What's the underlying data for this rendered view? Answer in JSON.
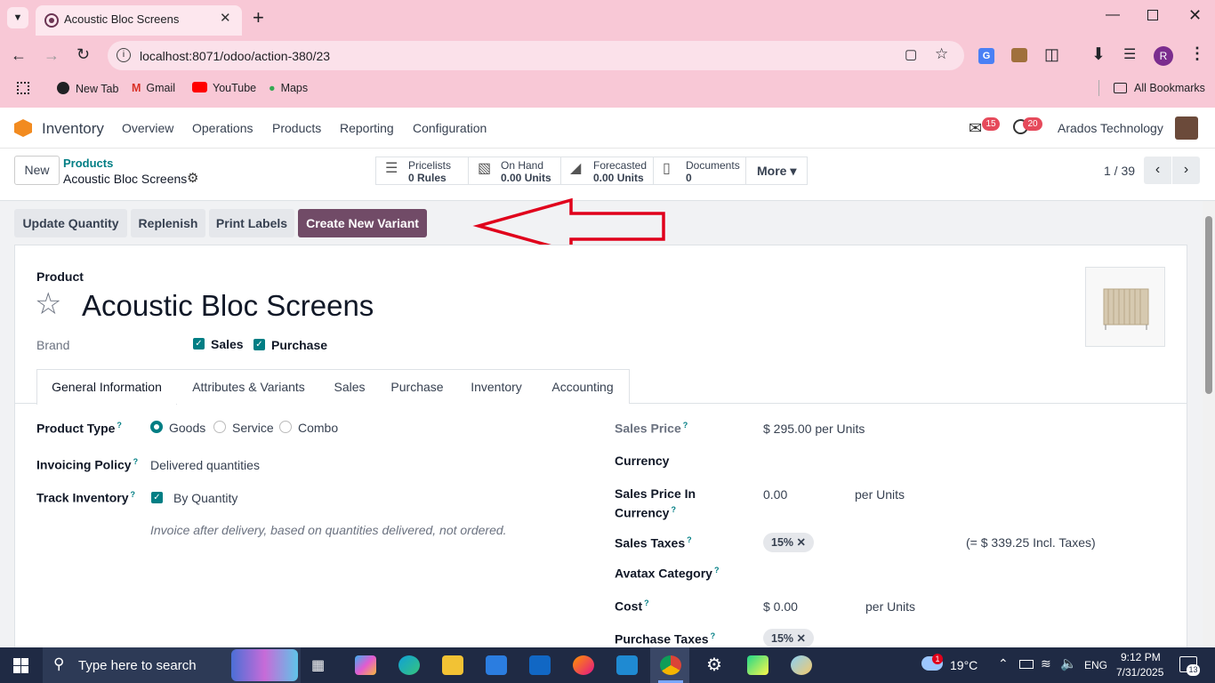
{
  "browser": {
    "tab_title": "Acoustic Bloc Screens",
    "new_tab_symbol": "+",
    "url": "localhost:8071/odoo/action-380/23",
    "bookmarks": [
      "New Tab",
      "Gmail",
      "YouTube",
      "Maps"
    ],
    "all_bookmarks": "All Bookmarks",
    "profile_initial": "R"
  },
  "app": {
    "name": "Inventory",
    "menu": [
      "Overview",
      "Operations",
      "Products",
      "Reporting",
      "Configuration"
    ],
    "chat_badge": "15",
    "activity_badge": "20",
    "company": "Arados Technology"
  },
  "control": {
    "new_label": "New",
    "breadcrumb_parent": "Products",
    "breadcrumb_current": "Acoustic Bloc Screens",
    "stats": [
      {
        "label": "Pricelists",
        "value": "0 Rules"
      },
      {
        "label": "On Hand",
        "value": "0.00 Units"
      },
      {
        "label": "Forecasted",
        "value": "0.00 Units"
      },
      {
        "label": "Documents",
        "value": "0"
      }
    ],
    "more_label": "More",
    "pager": "1 / 39"
  },
  "actions": [
    "Update Quantity",
    "Replenish",
    "Print Labels",
    "Create New Variant"
  ],
  "form": {
    "product_label": "Product",
    "product_name": "Acoustic Bloc Screens",
    "brand_label": "Brand",
    "sales_check": "Sales",
    "purchase_check": "Purchase",
    "tabs": [
      "General Information",
      "Attributes & Variants",
      "Sales",
      "Purchase",
      "Inventory",
      "Accounting"
    ],
    "product_type_label": "Product Type",
    "product_type_options": [
      "Goods",
      "Service",
      "Combo"
    ],
    "invoicing_policy_label": "Invoicing Policy",
    "invoicing_policy_value": "Delivered quantities",
    "track_inventory_label": "Track Inventory",
    "track_inventory_value": "By Quantity",
    "invoice_hint": "Invoice after delivery, based on quantities delivered, not ordered.",
    "sales_price_label": "Sales Price",
    "sales_price_value": "$ 295.00 per Units",
    "currency_label": "Currency",
    "sales_price_currency_label_1": "Sales Price In",
    "sales_price_currency_label_2": "Currency",
    "sales_price_currency_value": "0.00",
    "sales_price_currency_unit": "per Units",
    "sales_taxes_label": "Sales Taxes",
    "sales_taxes_tag": "15%",
    "sales_taxes_incl": "(= $ 339.25 Incl. Taxes)",
    "avatax_label": "Avatax Category",
    "cost_label": "Cost",
    "cost_value": "$ 0.00",
    "cost_unit": "per Units",
    "purchase_taxes_label": "Purchase Taxes",
    "purchase_taxes_tag": "15%"
  },
  "taskbar": {
    "search_placeholder": "Type here to search",
    "temperature": "19°C",
    "lang": "ENG",
    "time": "9:12 PM",
    "date": "7/31/2025",
    "notification_count": "13",
    "weather_badge": "1"
  },
  "colors": {
    "brand": "#714b67",
    "accent": "#017e84",
    "chrome": "#f8c8d6",
    "annotation": "#e0001b"
  }
}
